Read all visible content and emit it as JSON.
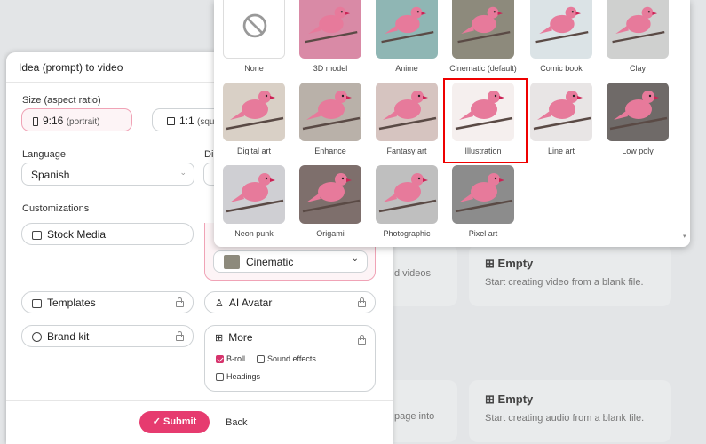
{
  "dialog": {
    "title": "Idea (prompt) to video",
    "size_label": "Size (aspect ratio)",
    "size_options": [
      {
        "ratio": "9:16",
        "desc": "(portrait)",
        "selected": true
      },
      {
        "ratio": "1:1",
        "desc": "(squ",
        "selected": false
      }
    ],
    "language_label": "Language",
    "language_value": "Spanish",
    "partial_label": "Di",
    "customizations_label": "Customizations",
    "stock_media": "Stock Media",
    "style_value": "Cinematic",
    "templates": "Templates",
    "ai_avatar": "AI Avatar",
    "brand_kit": "Brand kit",
    "more": "More",
    "checkboxes": [
      {
        "label": "B-roll",
        "checked": true
      },
      {
        "label": "Sound effects",
        "checked": false
      },
      {
        "label": "Headings",
        "checked": false
      }
    ],
    "submit": "Submit",
    "back": "Back"
  },
  "background": {
    "cards": [
      {
        "title": "Empty",
        "desc": "Start creating video from a blank file."
      },
      {
        "title": "Empty",
        "desc": "Start creating audio from a blank file."
      }
    ],
    "partial_texts": [
      "d videos",
      "page into"
    ]
  },
  "styles": [
    {
      "label": "None",
      "color": "#ffffff",
      "selected": false
    },
    {
      "label": "3D model",
      "color": "#d98aa6",
      "selected": false
    },
    {
      "label": "Anime",
      "color": "#8fb6b4",
      "selected": false
    },
    {
      "label": "Cinematic (default)",
      "color": "#8d8a7c",
      "selected": false
    },
    {
      "label": "Comic book",
      "color": "#dbe3e6",
      "selected": false
    },
    {
      "label": "Clay",
      "color": "#cfd0cf",
      "selected": false
    },
    {
      "label": "Digital art",
      "color": "#d9d0c6",
      "selected": false
    },
    {
      "label": "Enhance",
      "color": "#b9b1a9",
      "selected": false
    },
    {
      "label": "Fantasy art",
      "color": "#d6c4c0",
      "selected": false
    },
    {
      "label": "Illustration",
      "color": "#f5efee",
      "selected": true
    },
    {
      "label": "Line art",
      "color": "#e8e5e5",
      "selected": false
    },
    {
      "label": "Low poly",
      "color": "#6f6a68",
      "selected": false
    },
    {
      "label": "Neon punk",
      "color": "#cfcfd3",
      "selected": false
    },
    {
      "label": "Origami",
      "color": "#7e6f6c",
      "selected": false
    },
    {
      "label": "Photographic",
      "color": "#bfbfbf",
      "selected": false
    },
    {
      "label": "Pixel art",
      "color": "#8c8c8c",
      "selected": false
    }
  ],
  "colors": {
    "accent": "#e63b6f",
    "pink_bird": "#e77a9b"
  }
}
